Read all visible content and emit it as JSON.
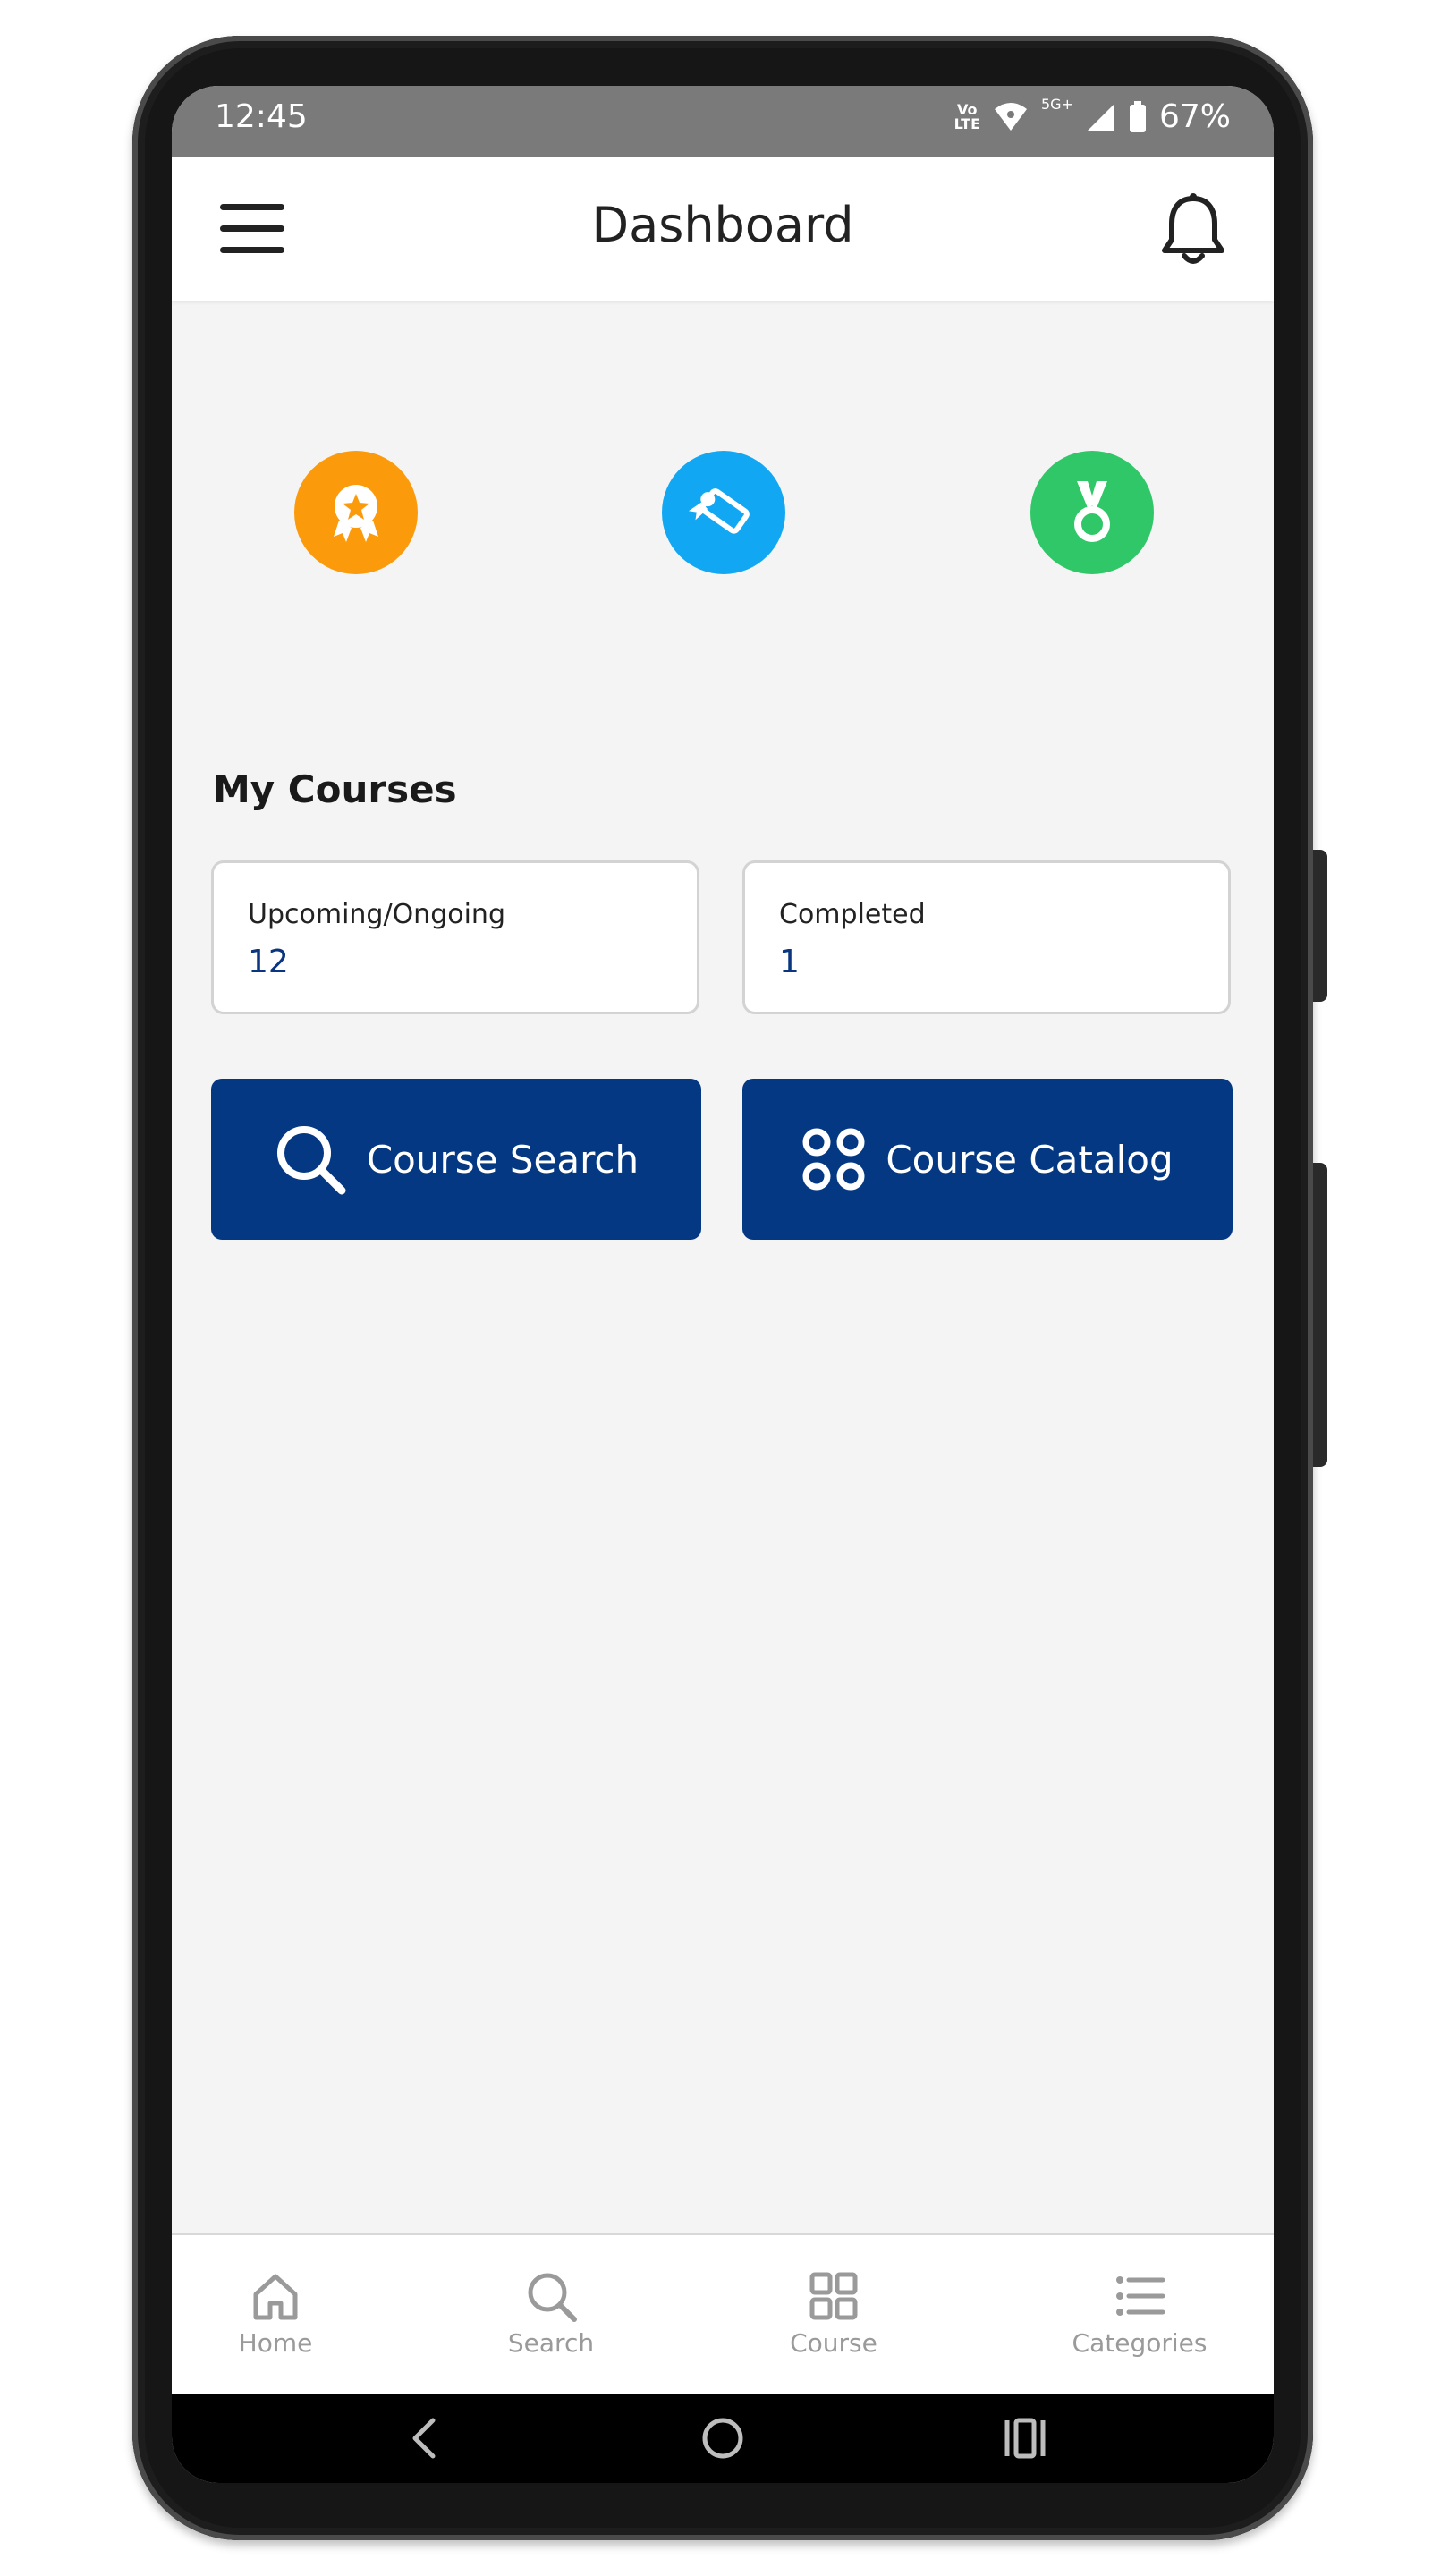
{
  "status_bar": {
    "time": "12:45",
    "network_top": "Vo",
    "network_bottom": "LTE",
    "network_5g": "5G+",
    "battery": "67%"
  },
  "app_bar": {
    "title": "Dashboard",
    "menu_icon": "hamburger-menu-icon",
    "notification_icon": "bell-icon"
  },
  "badges": [
    {
      "icon": "award-ribbon-icon",
      "color": "#fb9b0b"
    },
    {
      "icon": "certificate-scroll-icon",
      "color": "#12a7f3"
    },
    {
      "icon": "medal-icon",
      "color": "#30c768"
    }
  ],
  "my_courses": {
    "title": "My Courses",
    "stats": [
      {
        "label": "Upcoming/Ongoing",
        "value": "12"
      },
      {
        "label": "Completed",
        "value": "1"
      }
    ]
  },
  "actions": {
    "search_label": "Course Search",
    "catalog_label": "Course Catalog",
    "button_color": "#043882"
  },
  "bottom_nav": {
    "items": [
      {
        "label": "Home",
        "icon": "home-icon"
      },
      {
        "label": "Search",
        "icon": "search-icon"
      },
      {
        "label": "Course",
        "icon": "grid-icon"
      },
      {
        "label": "Categories",
        "icon": "list-icon"
      }
    ]
  },
  "system_nav": {
    "back_icon": "back-chevron-icon",
    "home_icon": "home-circle-icon",
    "recents_icon": "recents-icon"
  }
}
